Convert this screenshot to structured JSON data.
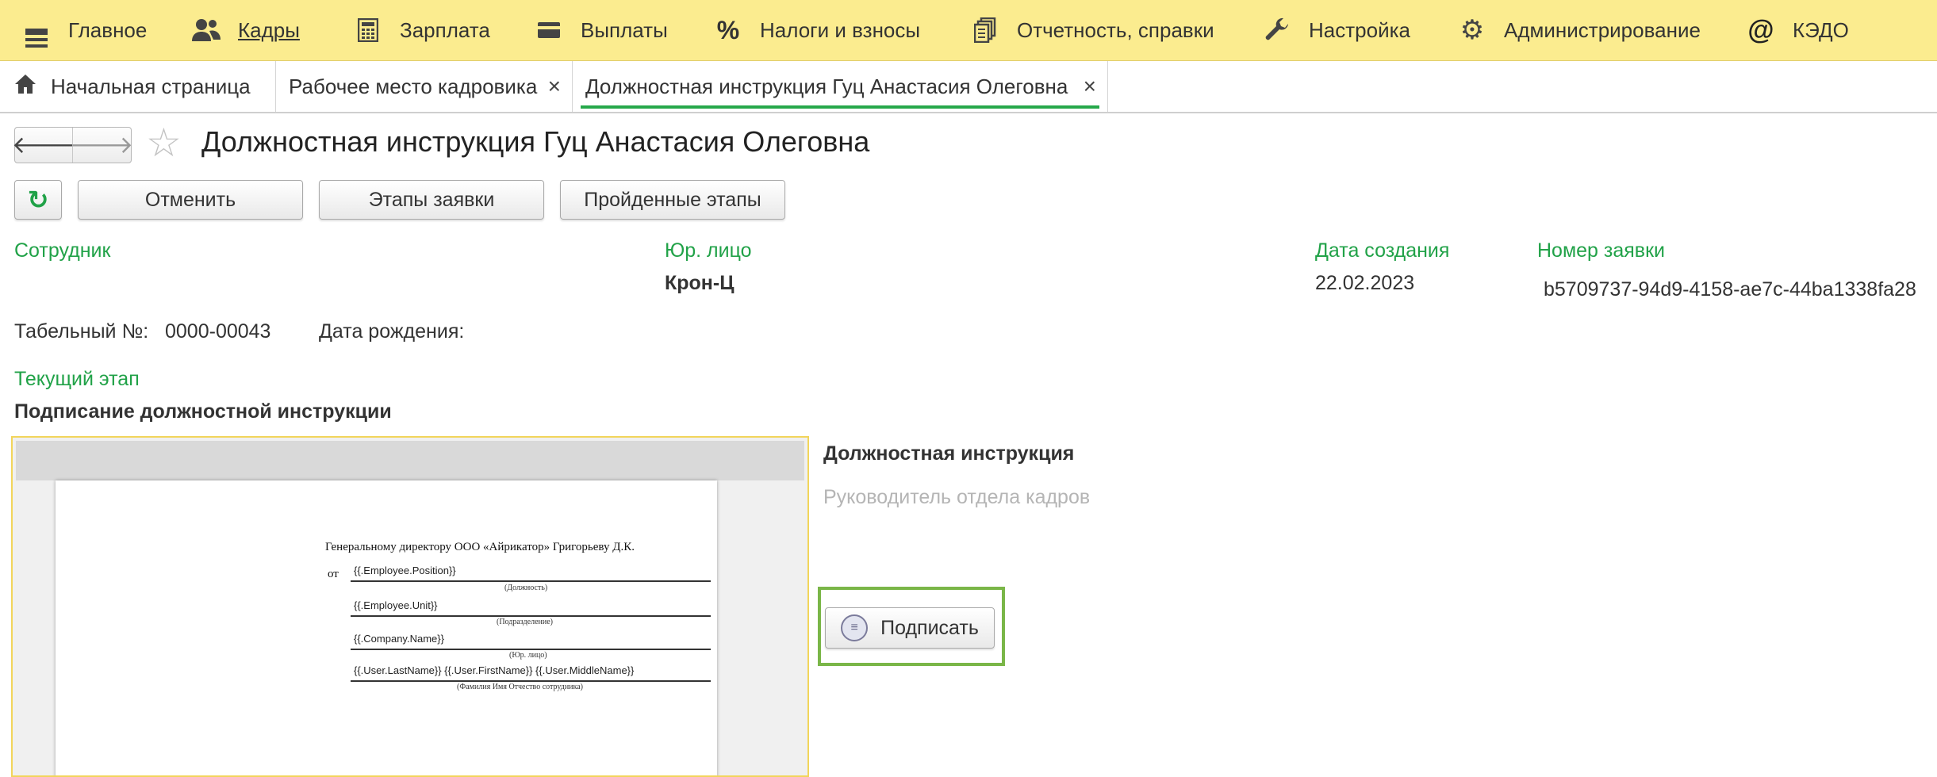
{
  "menu": [
    {
      "label": "Главное",
      "icon": "menu-burger-icon"
    },
    {
      "label": "Кадры",
      "icon": "people-icon"
    },
    {
      "label": "Зарплата",
      "icon": "calculator-icon"
    },
    {
      "label": "Выплаты",
      "icon": "wallet-icon"
    },
    {
      "label": "Налоги и взносы",
      "icon": "percent-icon"
    },
    {
      "label": "Отчетность, справки",
      "icon": "documents-icon"
    },
    {
      "label": "Настройка",
      "icon": "wrench-icon"
    },
    {
      "label": "Администрирование",
      "icon": "gear-icon"
    },
    {
      "label": "КЭДО",
      "icon": "at-icon"
    }
  ],
  "tabs": [
    {
      "label": "Начальная страница",
      "icon": "home-icon"
    },
    {
      "label": "Рабочее место кадровика",
      "close": "×"
    },
    {
      "label": "Должностная инструкция Гуц Анастасия Олеговна",
      "close": "×"
    }
  ],
  "header": {
    "back": "🡐",
    "forward": "🡒",
    "favorite": "☆",
    "title": "Должностная инструкция Гуц Анастасия Олеговна"
  },
  "toolbar": {
    "refresh": "↻",
    "cancel": "Отменить",
    "stages": "Этапы заявки",
    "passed": "Пройденные этапы"
  },
  "fields": {
    "employee_label": "Сотрудник",
    "legal_label": "Юр. лицо",
    "legal_value": "Крон-Ц",
    "date_label": "Дата создания",
    "date_value": "22.02.2023",
    "number_label": "Номер заявки",
    "number_value": "b5709737-94d9-4158-ae7c-44ba1338fa28",
    "tab_no_label": "Табельный №:",
    "tab_no_value": "0000-00043",
    "birth_label": "Дата рождения:",
    "stage_label": "Текущий этап",
    "stage_value": "Подписание должностной инструкции"
  },
  "document": {
    "heading": "Генеральному директору ООО «Айрикатор» Григорьеву Д.К.",
    "from": "от",
    "line1": "{{.Employee.Position}}",
    "cap1": "(Должность)",
    "line2": "{{.Employee.Unit}}",
    "cap2": "(Подразделение)",
    "line3": "{{.Company.Name}}",
    "cap3": "(Юр. лицо)",
    "line4": "{{.User.LastName}} {{.User.FirstName}} {{.User.MiddleName}}",
    "cap4": "(Фамилия Имя Отчество сотрудника)"
  },
  "panel": {
    "title": "Должностная инструкция",
    "placeholder": "Руководитель отдела кадров",
    "sign": "Подписать"
  },
  "colors": {
    "menubar": "#fbec8f",
    "accent_green": "#21a248",
    "highlight_green": "#7ab648",
    "preview_border": "#f2d55b"
  }
}
